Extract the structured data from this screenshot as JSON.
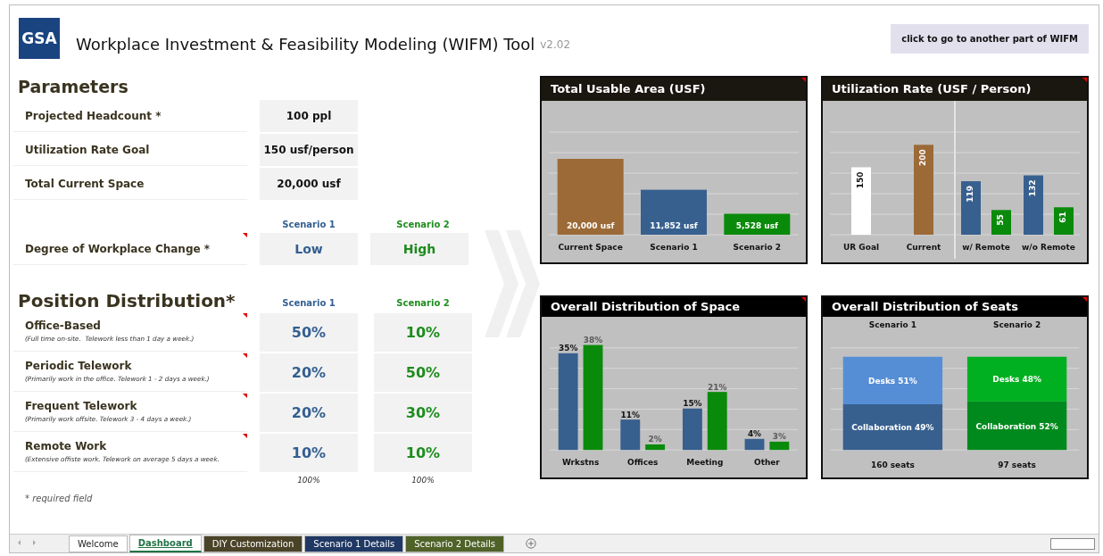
{
  "header": {
    "logo": "GSA",
    "title": "Workplace Investment & Feasibility Modeling (WIFM) Tool",
    "version": "v2.02",
    "nav_button": "click to go to another part of WIFM"
  },
  "parameters": {
    "title": "Parameters",
    "rows": [
      {
        "label": "Projected Headcount *",
        "value": "100 ppl"
      },
      {
        "label": "Utilization Rate Goal",
        "value": "150 usf/person"
      },
      {
        "label": "Total Current Space",
        "value": "20,000 usf"
      }
    ]
  },
  "workplace_change": {
    "headers": [
      {
        "label": "Scenario 1",
        "color": "#335f91"
      },
      {
        "label": "Scenario 2",
        "color": "#1e8c1e"
      }
    ],
    "label": "Degree of Workplace Change *",
    "has_comment": true,
    "values": [
      "Low",
      "High"
    ]
  },
  "positions": {
    "title": "Position Distribution*",
    "headers": [
      {
        "label": "Scenario 1",
        "color": "#335f91"
      },
      {
        "label": "Scenario 2",
        "color": "#1e8c1e"
      }
    ],
    "rows": [
      {
        "label": "Office-Based",
        "note": "(Full time on-site.  Telework less than 1 day a week.)",
        "has_comment": true,
        "values": [
          "50%",
          "10%"
        ]
      },
      {
        "label": "Periodic Telework",
        "note": "(Primarily work in the office. Telework 1 - 2 days a week.)",
        "has_comment": true,
        "values": [
          "20%",
          "50%"
        ]
      },
      {
        "label": "Frequent Telework",
        "note": "(Primarily work offsite. Telework 3 - 4 days a week.)",
        "has_comment": true,
        "values": [
          "20%",
          "30%"
        ]
      },
      {
        "label": "Remote Work",
        "note": "(Extensive offiste work. Telework on average 5 days a week.",
        "has_comment": true,
        "values": [
          "10%",
          "10%"
        ]
      }
    ],
    "totals": [
      "100%",
      "100%"
    ]
  },
  "required_note": "* required field",
  "charts": [
    {
      "title": "Total Usable Area (USF)",
      "kind": "area",
      "has_comment": true,
      "chart_data": {
        "type": "bar",
        "categories": [
          "Current Space",
          "Scenario 1",
          "Scenario 2"
        ],
        "series": [
          {
            "color": "#9c6a37",
            "values": [
              20000,
              null,
              null
            ],
            "value_labels": [
              "20,000 usf",
              null,
              null
            ]
          },
          {
            "color": "#37608f",
            "values": [
              null,
              11852,
              null
            ],
            "value_labels": [
              null,
              "11,852 usf",
              null
            ]
          },
          {
            "color": "#0a8a0a",
            "values": [
              null,
              null,
              5528
            ],
            "value_labels": [
              null,
              null,
              "5,528 usf"
            ]
          }
        ]
      }
    },
    {
      "title": "Utilization Rate (USF / Person)",
      "kind": "rate",
      "has_comment": true,
      "chart_data": {
        "type": "bar",
        "categories": [
          "UR Goal",
          "Current",
          "w/ Remote",
          "w/o Remote"
        ],
        "series": [
          {
            "color": "#ffffff",
            "values": [
              150,
              null,
              null,
              null
            ],
            "value_labels": [
              "150",
              null,
              null,
              null
            ]
          },
          {
            "color": "#9c6a37",
            "values": [
              null,
              200,
              null,
              null
            ],
            "value_labels": [
              null,
              "200",
              null,
              null
            ]
          },
          {
            "color": "#37608f",
            "values": [
              null,
              null,
              119,
              132
            ],
            "value_labels": [
              null,
              null,
              "119",
              "132"
            ]
          },
          {
            "color": "#0a8a0a",
            "values": [
              null,
              null,
              55,
              61
            ],
            "value_labels": [
              null,
              null,
              "55",
              "61"
            ]
          }
        ]
      }
    },
    {
      "title": "Overall Distribution of Space",
      "kind": "space",
      "has_comment": true,
      "chart_data": {
        "type": "bar",
        "categories": [
          "Wrkstns",
          "Offices",
          "Meeting",
          "Other"
        ],
        "series": [
          {
            "color": "#37608f",
            "values": [
              35,
              11,
              15,
              4
            ],
            "value_labels": [
              "35%",
              "11%",
              "15%",
              "4%"
            ]
          },
          {
            "color": "#0a8a0a",
            "values": [
              38,
              2,
              21,
              3
            ],
            "value_labels": [
              "38%",
              "2%",
              "21%",
              "3%"
            ]
          }
        ]
      }
    },
    {
      "title": "Overall Distribution of Seats",
      "kind": "seats",
      "has_comment": true,
      "totals": [
        "160 seats",
        "97 seats"
      ],
      "chart_data": {
        "type": "bar",
        "stacked": true,
        "categories": [
          "Scenario 1",
          "Scenario 2"
        ],
        "series": [
          {
            "colors": [
              "#37608f",
              "#008a1e"
            ],
            "values": [
              49,
              52
            ],
            "value_labels": [
              "Collaboration 49%",
              "Collaboration 52%"
            ]
          },
          {
            "colors": [
              "#558ed5",
              "#00b020"
            ],
            "values": [
              51,
              48
            ],
            "value_labels": [
              "Desks 51%",
              "Desks 48%"
            ]
          }
        ]
      }
    }
  ],
  "sheet_tabs": [
    {
      "label": "Welcome",
      "selected": false,
      "color": "#ffffff"
    },
    {
      "label": "Dashboard",
      "selected": true,
      "color": "#ffffff"
    },
    {
      "label": "DIY Customization",
      "selected": false,
      "color": "#4a4328"
    },
    {
      "label": "Scenario 1 Details",
      "selected": false,
      "color": "#1f3864"
    },
    {
      "label": "Scenario 2 Details",
      "selected": false,
      "color": "#4f6228"
    }
  ]
}
